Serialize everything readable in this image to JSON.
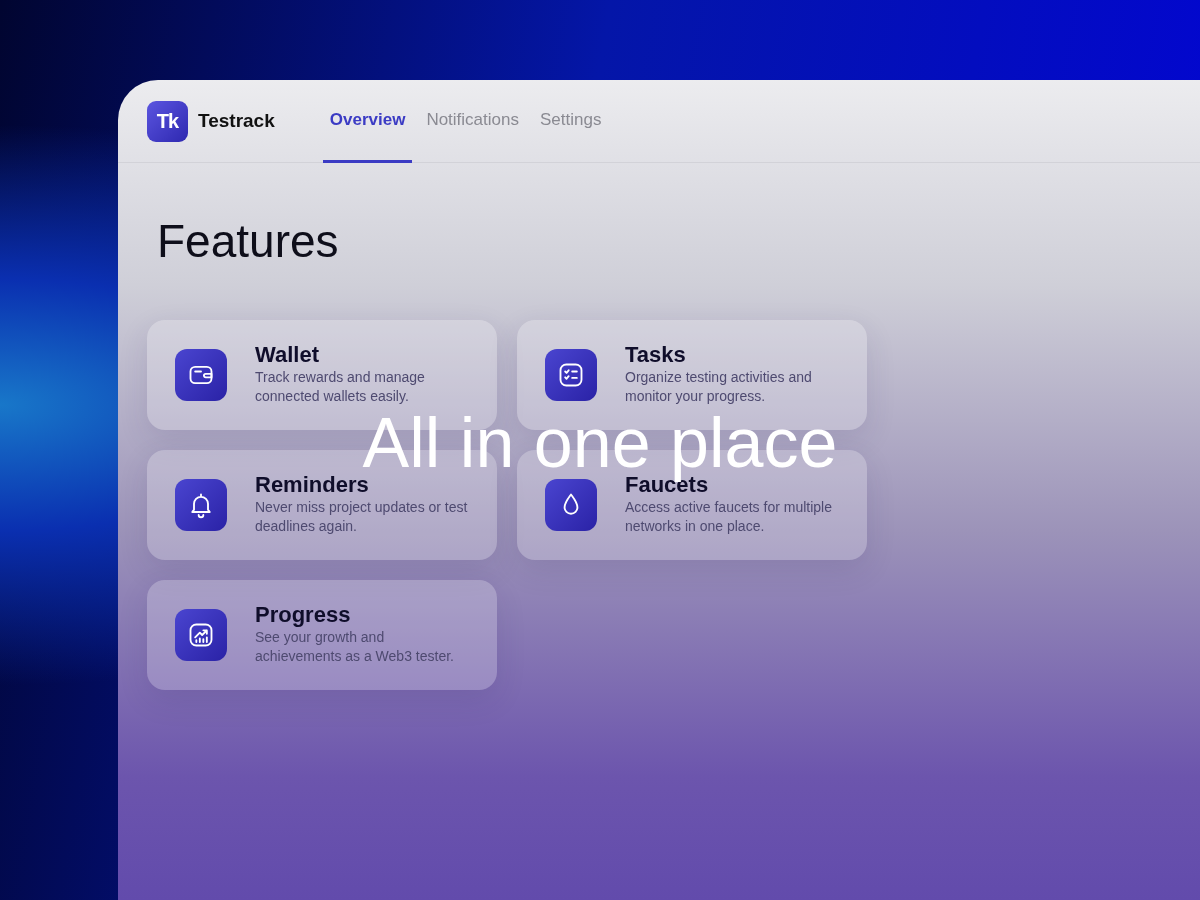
{
  "app": {
    "logo_mark": "Tk",
    "name": "Testrack"
  },
  "tabs": [
    {
      "label": "Overview",
      "selected": true
    },
    {
      "label": "Notifications",
      "selected": false
    },
    {
      "label": "Settings",
      "selected": false
    }
  ],
  "page_title": "Features",
  "features": [
    {
      "kind": "wallet",
      "title": "Wallet",
      "description": "Track rewards and manage connected wallets easily."
    },
    {
      "kind": "tasks",
      "title": "Tasks",
      "description": "Organize testing activities and monitor your progress."
    },
    {
      "kind": "bell",
      "title": "Reminders",
      "description": "Never miss project updates or test deadlines again."
    },
    {
      "kind": "drop",
      "title": "Faucets",
      "description": "Access active faucets for multiple networks in one place."
    },
    {
      "kind": "chart",
      "title": "Progress",
      "description": "See your growth and achievements as a Web3 tester."
    }
  ],
  "headline": "All in one place"
}
